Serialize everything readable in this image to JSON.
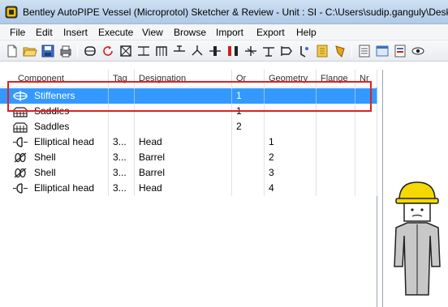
{
  "window": {
    "title": "Bentley AutoPIPE Vessel (Microprotol) Sketcher & Review  - Unit : SI - C:\\Users\\sudip.ganguly\\Desk"
  },
  "menu": [
    "File",
    "Edit",
    "Insert",
    "Execute",
    "View",
    "Browse",
    "Import",
    "Export",
    "Help"
  ],
  "toolbar_icons": [
    "new-file-icon",
    "open-folder-icon",
    "save-icon",
    "print-icon",
    "vessel-icon",
    "rotate-icon",
    "section-icon",
    "head-icon",
    "support-icon",
    "nozzle-icon",
    "branch-icon",
    "flange-icon",
    "saddle-icon",
    "stiffener-icon",
    "lug-icon",
    "skirt-icon",
    "bracket-icon",
    "report-icon",
    "list-icon",
    "window-icon",
    "sheet-icon",
    "view-icon"
  ],
  "table": {
    "columns": [
      "Component",
      "Tag",
      "Designation",
      "Or",
      "Geometry",
      "Flange",
      "Nr"
    ],
    "rows": [
      {
        "icon": "stiffener-icon",
        "component": "Stiffeners",
        "tag": "",
        "designation": "",
        "or": "1",
        "geometry": "",
        "flange": "",
        "nr": "",
        "selected": true
      },
      {
        "icon": "saddle-icon",
        "component": "Saddles",
        "tag": "",
        "designation": "",
        "or": "1",
        "geometry": "",
        "flange": "",
        "nr": "",
        "selected": false
      },
      {
        "icon": "saddle-icon",
        "component": "Saddles",
        "tag": "",
        "designation": "",
        "or": "2",
        "geometry": "",
        "flange": "",
        "nr": "",
        "selected": false
      },
      {
        "icon": "elliptical-head-icon",
        "component": "Elliptical head",
        "tag": "3...",
        "designation": "Head",
        "or": "",
        "geometry": "1",
        "flange": "",
        "nr": "",
        "selected": false
      },
      {
        "icon": "shell-icon",
        "component": "Shell",
        "tag": "3...",
        "designation": "Barrel",
        "or": "",
        "geometry": "2",
        "flange": "",
        "nr": "",
        "selected": false
      },
      {
        "icon": "shell-icon",
        "component": "Shell",
        "tag": "3...",
        "designation": "Barrel",
        "or": "",
        "geometry": "3",
        "flange": "",
        "nr": "",
        "selected": false
      },
      {
        "icon": "elliptical-head-icon",
        "component": "Elliptical head",
        "tag": "3...",
        "designation": "Head",
        "or": "",
        "geometry": "4",
        "flange": "",
        "nr": "",
        "selected": false
      }
    ]
  },
  "colors": {
    "selection": "#3399ff",
    "highlight_box": "#e02020",
    "hard_hat": "#f5d800",
    "figure_body": "#c8c8c8"
  }
}
